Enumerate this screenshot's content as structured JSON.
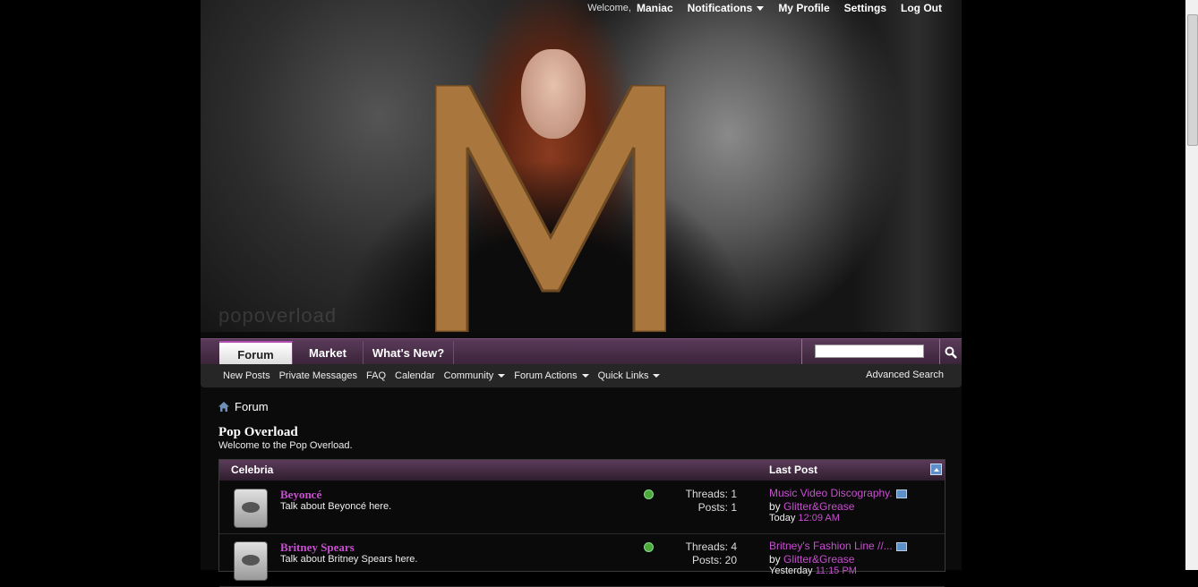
{
  "header": {
    "watermark": "popoverload",
    "welcome": "Welcome,",
    "username": "Maniac",
    "links": [
      "Notifications",
      "My Profile",
      "Settings",
      "Log Out"
    ]
  },
  "nav": {
    "tabs": [
      "Forum",
      "Market",
      "What's New?"
    ],
    "search_placeholder": ""
  },
  "subnav": {
    "items": [
      "New Posts",
      "Private Messages",
      "FAQ",
      "Calendar",
      "Community",
      "Forum Actions",
      "Quick Links"
    ],
    "advanced_search": "Advanced Search"
  },
  "breadcrumb": {
    "label": "Forum"
  },
  "page": {
    "title": "Pop Overload",
    "description": "Welcome to the Pop Overload."
  },
  "category": {
    "name": "Celebria",
    "last_post_header": "Last Post",
    "forums": [
      {
        "name": "Beyoncé",
        "description": "Talk about Beyoncé here.",
        "threads": "Threads: 1",
        "posts": "Posts: 1",
        "last_post_title": "Music Video Discography.",
        "last_post_by": "by",
        "last_post_user": "Glitter&Grease",
        "last_post_day": "Today",
        "last_post_time": "12:09 AM"
      },
      {
        "name": "Britney Spears",
        "description": "Talk about Britney Spears here.",
        "threads": "Threads: 4",
        "posts": "Posts: 20",
        "last_post_title": "Britney's Fashion Line //...",
        "last_post_by": "by",
        "last_post_user": "Glitter&Grease",
        "last_post_day": "Yesterday",
        "last_post_time": "11:15 PM"
      }
    ]
  },
  "colors": {
    "accent": "#c84fd0",
    "nav": "#4a2e49",
    "status_new": "#4caa3d"
  }
}
